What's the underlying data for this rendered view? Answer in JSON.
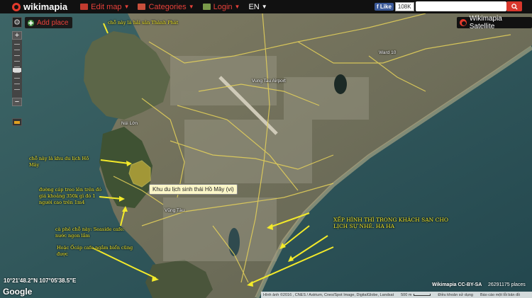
{
  "header": {
    "brand": "wikimapia",
    "menu": [
      {
        "label": "Edit map",
        "icon": "edit-icon"
      },
      {
        "label": "Categories",
        "icon": "categories-icon"
      },
      {
        "label": "Login",
        "icon": "login-icon"
      },
      {
        "label": "EN"
      }
    ],
    "facebook": {
      "like_label": "Like",
      "count": "108K"
    },
    "search": {
      "placeholder": "",
      "value": ""
    }
  },
  "map_controls": {
    "add_place": "Add place",
    "layer": "Wikimapia Satellite"
  },
  "map_labels": {
    "airport": "Vung Tau Airport",
    "ward": "Ward 10",
    "nui_lon": "Núi Lớn",
    "vung_tau": "Vũng Tàu"
  },
  "tooltip": "Khu du lịch sinh thái Hồ Mây (vi)",
  "annotations": {
    "seafood": "chỗ này là hải sản Thành Phát",
    "ho_may": "chỗ này là khu du lịch Hồ Mây",
    "cable_car": "đường cáp treo lên trên đó giá khoảng 350k gì đó 1 người cao trên 1m4",
    "cafe": "cà phê chỗ này: Seaside cafe: nước ngon lắm",
    "ocap": "Hoặc Ốcáp cafe ngắm biển cũng được",
    "hotel": "XẾP HÌNH THÌ TRONG KHÁCH SẠN CHO LỊCH SỰ NHÉ. HA HA"
  },
  "footer": {
    "coordinates": "10°21'48.2\"N 107°05'38.5\"E",
    "google": "Google",
    "credit": "Wikimapia CC-BY-SA",
    "places": "26291175 places",
    "attribution": "Hình ảnh ©2016 , CNES / Astrium, Cnes/Spot Image, DigitalGlobe, Landsat",
    "scale": "500 m",
    "terms": "Điều khoản sử dụng",
    "report": "Báo cáo một lỗi bản đồ"
  },
  "colors": {
    "annotation": "#f3ea2a",
    "brand_red": "#e8413a",
    "sea": "#2c4f55",
    "road": "#e7d35a"
  }
}
